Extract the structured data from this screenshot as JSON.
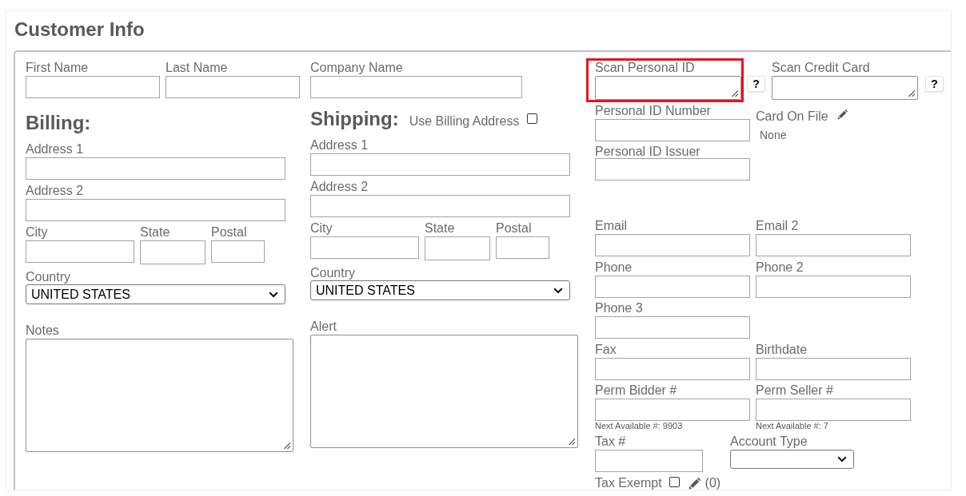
{
  "title": "Customer Info",
  "name_fields": [
    {
      "label": "First Name"
    },
    {
      "label": "Last Name"
    }
  ],
  "company_name": {
    "label": "Company Name"
  },
  "billing": {
    "heading": "Billing:",
    "address_1": {
      "label": "Address 1"
    },
    "address_2": {
      "label": "Address 2"
    },
    "city": {
      "label": "City"
    },
    "state": {
      "label": "State"
    },
    "postal": {
      "label": "Postal"
    },
    "country": {
      "label": "Country",
      "value": "UNITED STATES"
    }
  },
  "shipping": {
    "heading": "Shipping:",
    "use_billing_address": {
      "label": "Use Billing Address",
      "checked": false
    },
    "address_1": {
      "label": "Address 1"
    },
    "address_2": {
      "label": "Address 2"
    },
    "city": {
      "label": "City"
    },
    "state": {
      "label": "State"
    },
    "postal": {
      "label": "Postal"
    },
    "country": {
      "label": "Country",
      "value": "UNITED STATES"
    }
  },
  "notes": {
    "label": "Notes"
  },
  "alert": {
    "label": "Alert"
  },
  "scan_personal_id": {
    "label": "Scan Personal ID",
    "help_button": "?",
    "highlighted": true
  },
  "scan_credit_card": {
    "label": "Scan Credit Card",
    "help_button": "?"
  },
  "personal_id_number": {
    "label": "Personal ID Number"
  },
  "personal_id_issuer": {
    "label": "Personal ID Issuer"
  },
  "card_on_file": {
    "label": "Card On File",
    "value": "None"
  },
  "contact_rows": [
    {
      "fields": [
        {
          "label": "Email"
        },
        {
          "label": "Email 2"
        }
      ]
    },
    {
      "fields": [
        {
          "label": "Phone"
        },
        {
          "label": "Phone 2"
        }
      ]
    },
    {
      "fields": [
        {
          "label": "Phone 3"
        }
      ]
    },
    {
      "fields": [
        {
          "label": "Fax"
        },
        {
          "label": "Birthdate"
        }
      ]
    },
    {
      "fields": [
        {
          "label": "Perm Bidder #",
          "hint": "Next Available #: 9903"
        },
        {
          "label": "Perm Seller #",
          "hint": "Next Available #: 7"
        }
      ]
    }
  ],
  "tax_number": {
    "label": "Tax #"
  },
  "account_type": {
    "label": "Account Type"
  },
  "tax_exempt": {
    "label": "Tax Exempt",
    "checked": false,
    "count": "(0)"
  }
}
